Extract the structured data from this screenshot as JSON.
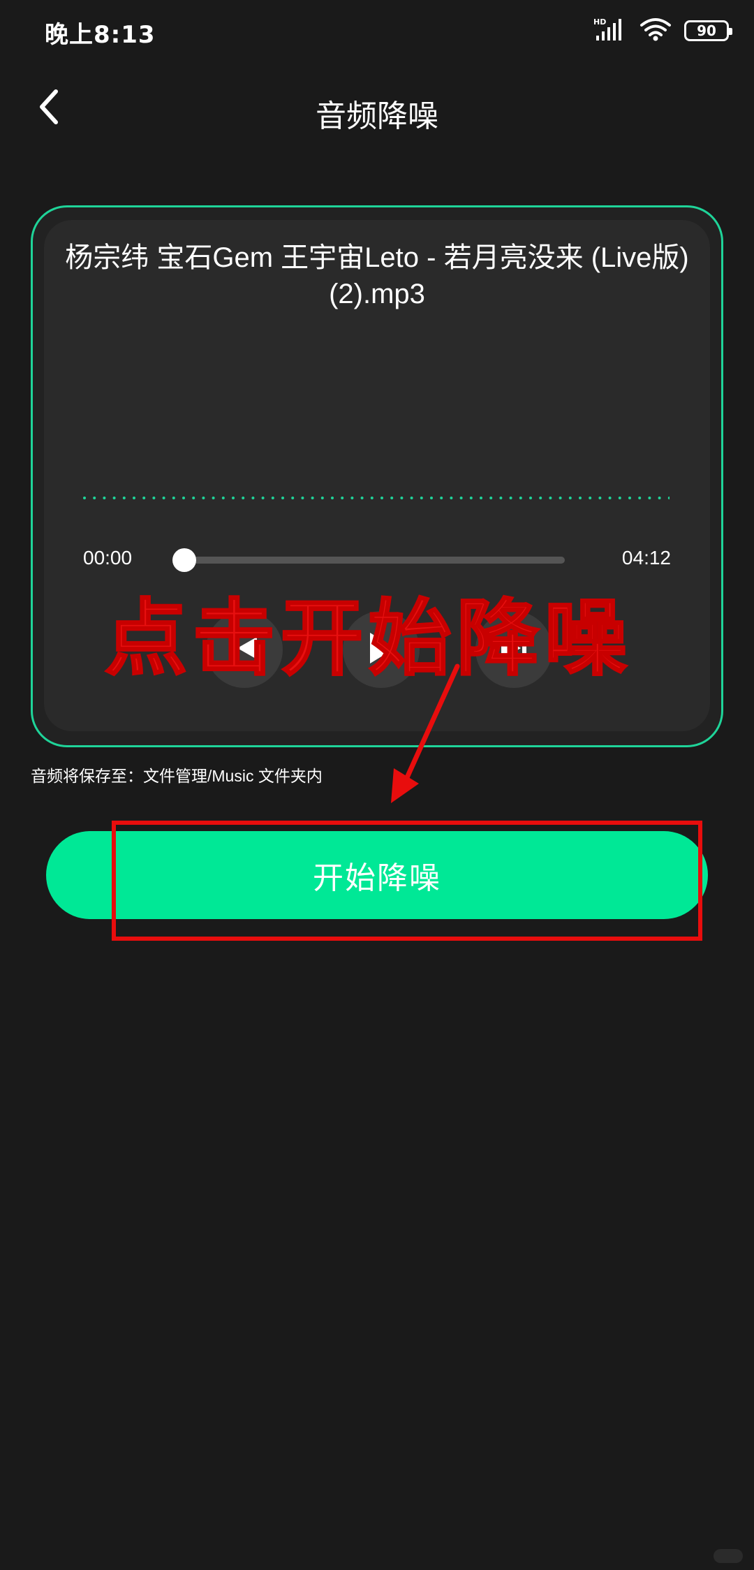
{
  "status_bar": {
    "time": "晚上8:13",
    "battery": "90",
    "icons": [
      "hd-signal-icon",
      "wifi-icon",
      "battery-icon"
    ]
  },
  "header": {
    "title": "音频降噪",
    "back_icon": "chevron-left-icon"
  },
  "player": {
    "file_name": "杨宗纬 宝石Gem 王宇宙Leto - 若月亮没来 (Live版)(2).mp3",
    "current_time": "00:00",
    "total_time": "04:12",
    "progress": 0,
    "accent_color": "#1fd499",
    "controls": [
      "previous-icon",
      "play-icon",
      "next-icon"
    ]
  },
  "save_info": "音频将保存至：文件管理/Music 文件夹内",
  "start_button": {
    "label": "开始降噪",
    "color": "#00e896"
  },
  "annotation": {
    "text": "点击开始降噪",
    "color": "#e81010"
  }
}
